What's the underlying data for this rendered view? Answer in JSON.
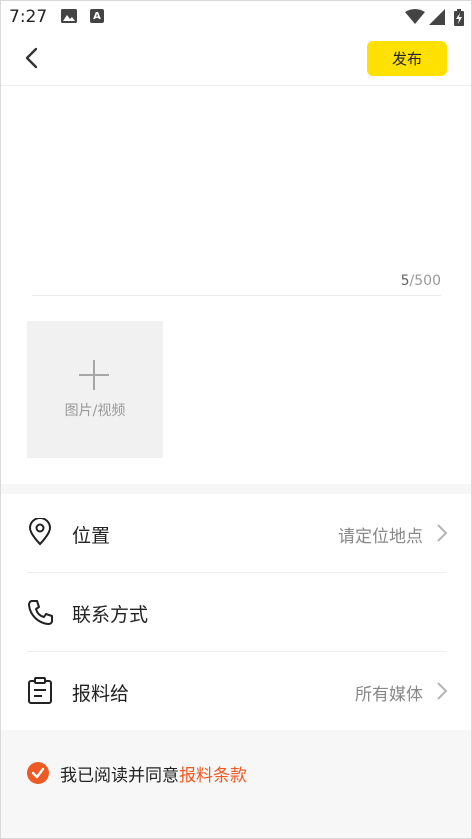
{
  "status_bar": {
    "time": "7:27",
    "icons": [
      "image-icon",
      "a-badge-icon",
      "wifi-icon",
      "signal-icon",
      "battery-icon"
    ]
  },
  "header": {
    "publish_label": "发布"
  },
  "editor": {
    "char_current": "5",
    "char_max": "/500",
    "value": ""
  },
  "media": {
    "label": "图片/视频"
  },
  "rows": {
    "location": {
      "label": "位置",
      "value": "请定位地点"
    },
    "contact": {
      "label": "联系方式"
    },
    "report_to": {
      "label": "报料给",
      "value": "所有媒体"
    }
  },
  "agreement": {
    "text": "我已阅读并同意",
    "link": "报料条款",
    "checked": true
  },
  "colors": {
    "accent": "#ffe100",
    "link": "#ee5a24",
    "check": "#ee5a24"
  }
}
